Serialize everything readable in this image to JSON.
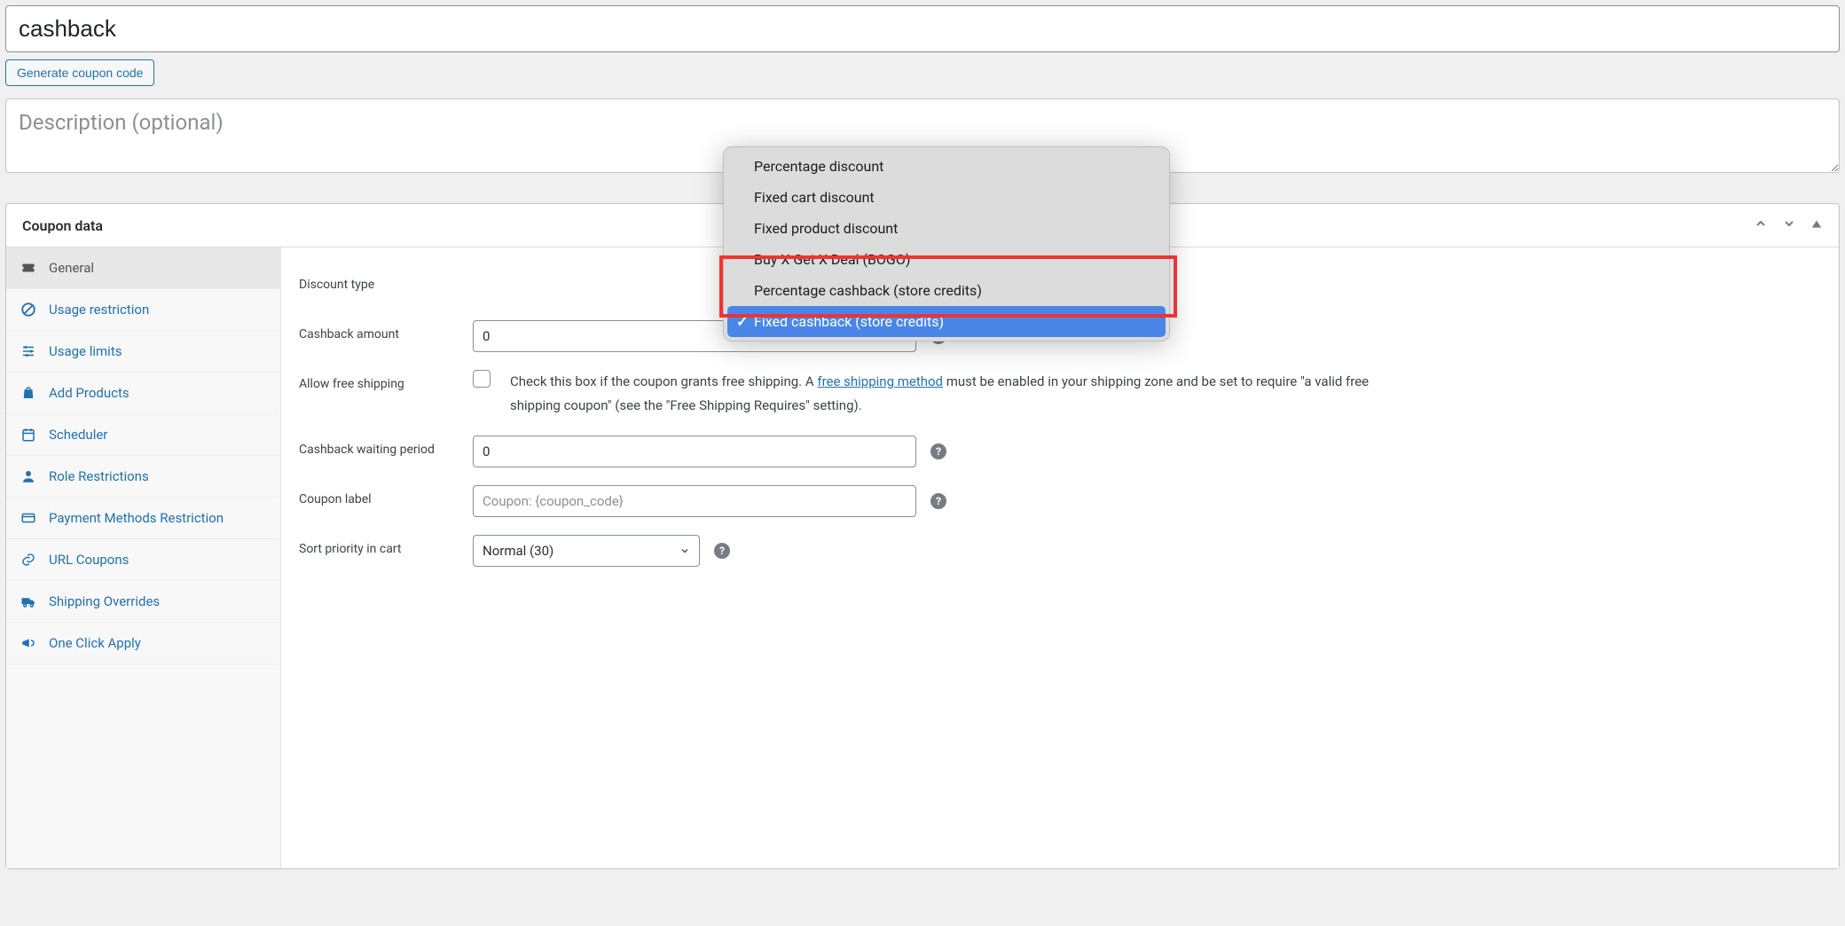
{
  "coupon": {
    "title_value": "cashback",
    "generate_btn": "Generate coupon code",
    "description_value": "",
    "description_placeholder": "Description (optional)"
  },
  "metabox": {
    "title": "Coupon data"
  },
  "tabs": [
    {
      "label": "General",
      "active": true,
      "icon": "ticket"
    },
    {
      "label": "Usage restriction",
      "active": false,
      "icon": "block"
    },
    {
      "label": "Usage limits",
      "active": false,
      "icon": "sliders"
    },
    {
      "label": "Add Products",
      "active": false,
      "icon": "bag"
    },
    {
      "label": "Scheduler",
      "active": false,
      "icon": "calendar"
    },
    {
      "label": "Role Restrictions",
      "active": false,
      "icon": "user"
    },
    {
      "label": "Payment Methods Restriction",
      "active": false,
      "icon": "card"
    },
    {
      "label": "URL Coupons",
      "active": false,
      "icon": "link"
    },
    {
      "label": "Shipping Overrides",
      "active": false,
      "icon": "truck"
    },
    {
      "label": "One Click Apply",
      "active": false,
      "icon": "megaphone"
    }
  ],
  "fields": {
    "discount_type_label": "Discount type",
    "cashback_amount_label": "Cashback amount",
    "cashback_amount_value": "0",
    "allow_free_shipping_label": "Allow free shipping",
    "free_ship_text_pre": "Check this box if the coupon grants free shipping. A ",
    "free_ship_link": "free shipping method",
    "free_ship_text_post": " must be enabled in your shipping zone and be set to require \"a valid free shipping coupon\" (see the \"Free Shipping Requires\" setting).",
    "cashback_waiting_label": "Cashback waiting period",
    "cashback_waiting_value": "0",
    "coupon_label_label": "Coupon label",
    "coupon_label_placeholder": "Coupon: {coupon_code}",
    "sort_priority_label": "Sort priority in cart",
    "sort_priority_value": "Normal (30)"
  },
  "discount_type_options": [
    "Percentage discount",
    "Fixed cart discount",
    "Fixed product discount",
    "Buy X Get X Deal (BOGO)",
    "Percentage cashback (store credits)",
    "Fixed cashback (store credits)"
  ],
  "discount_type_selected_index": 5
}
